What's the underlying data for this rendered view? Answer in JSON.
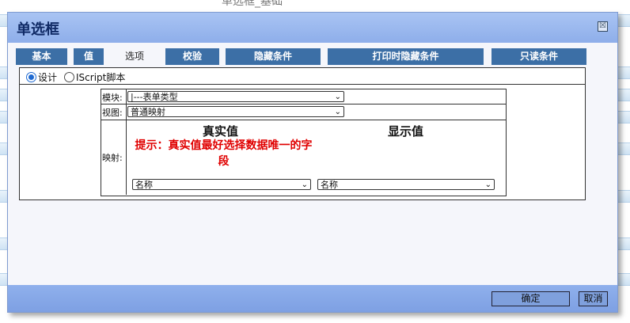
{
  "page": {
    "background_title": "单选框_基础"
  },
  "dialog": {
    "title": "单选框",
    "close_glyph": "☒"
  },
  "tabs": [
    {
      "label": "基本"
    },
    {
      "label": "值"
    },
    {
      "label": "选项"
    },
    {
      "label": "校验"
    },
    {
      "label": "隐藏条件"
    },
    {
      "label": "打印时隐藏条件"
    },
    {
      "label": "只读条件"
    }
  ],
  "mode": {
    "options": [
      {
        "label": "设计",
        "checked": true
      },
      {
        "label": "IScript脚本",
        "checked": false
      }
    ]
  },
  "form": {
    "module": {
      "label": "模块:",
      "value": "|---表单类型"
    },
    "view": {
      "label": "视图:",
      "value": "普通映射"
    },
    "mapping": {
      "label": "映射:",
      "real_header": "真实值",
      "display_header": "显示值",
      "tip": "提示：真实值最好选择数据唯一的字段",
      "real_value": "名称",
      "display_value": "名称"
    }
  },
  "footer": {
    "ok_label": "确定",
    "cancel_label": "取消"
  },
  "colors": {
    "tab_bg": "#3c6fa6",
    "tip": "#e00000",
    "titlebar": "#9bb8ee"
  }
}
